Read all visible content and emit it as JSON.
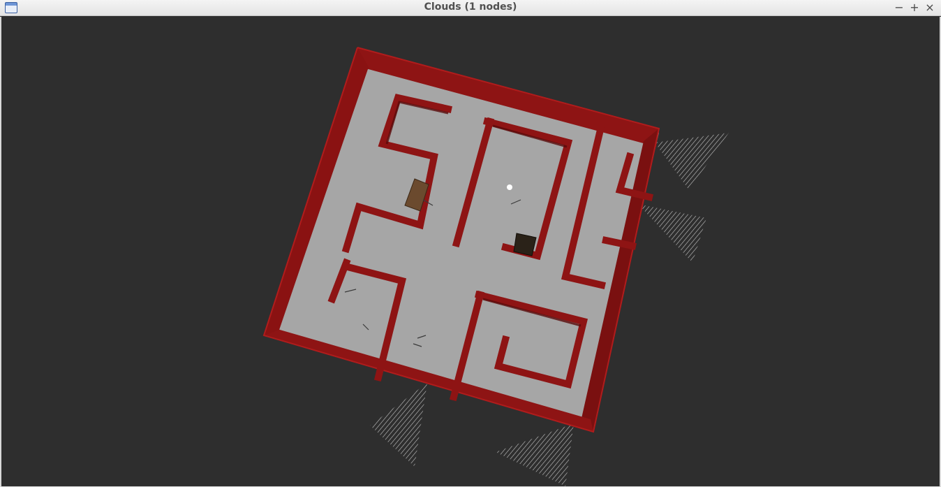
{
  "window": {
    "title": "Clouds (1 nodes)",
    "minimize_glyph": "−",
    "maximize_glyph": "+",
    "close_glyph": "×",
    "icon": "window-app-icon"
  },
  "scene": {
    "background_color": "#2e2e2e",
    "floor_color": "#a6a6a6",
    "wall_color": "#8e1414",
    "wall_side_color": "#6a0c0c",
    "scan_color": "#d8d8d8",
    "objects": [
      {
        "name": "brown-box",
        "color": "#6b4a2e"
      },
      {
        "name": "dark-box",
        "color": "#2a2218"
      },
      {
        "name": "robot-origin-marker",
        "color": "#ffffff"
      }
    ]
  }
}
